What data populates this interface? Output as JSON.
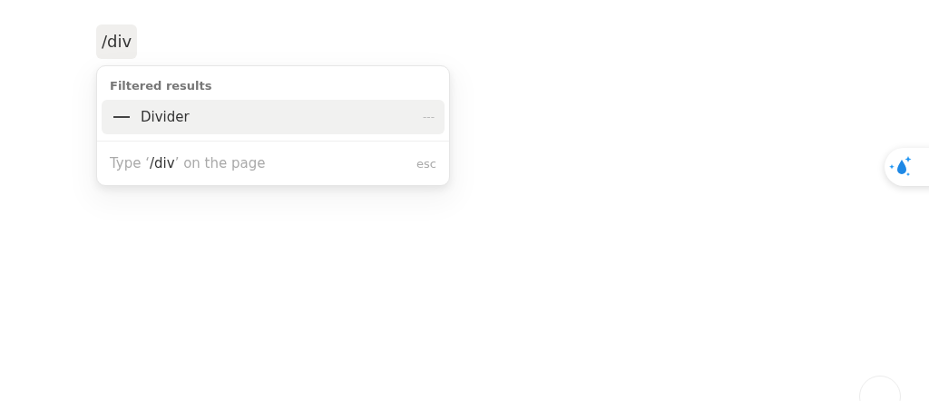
{
  "editor": {
    "typed_text": "/div"
  },
  "menu": {
    "section_title": "Filtered results",
    "items": [
      {
        "label": "Divider",
        "shortcut": "---",
        "kind": "divider",
        "selected": true
      }
    ],
    "footer": {
      "hint": "Type ‘**/div**’ on the page",
      "key": "esc"
    }
  }
}
